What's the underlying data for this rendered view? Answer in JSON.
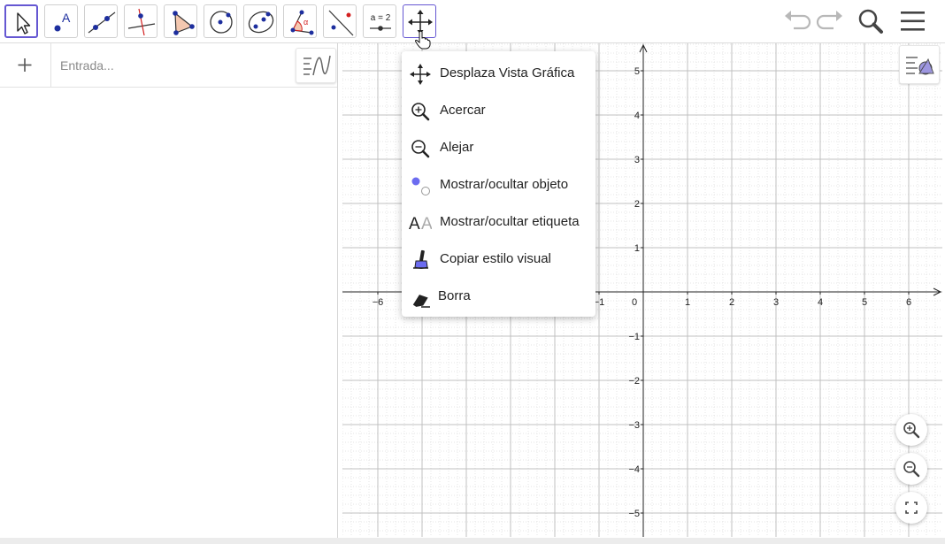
{
  "toolbar": {
    "tools": [
      {
        "name": "move-tool",
        "icon": "arrow-pointer-icon",
        "active": true
      },
      {
        "name": "point-tool",
        "icon": "point-label-icon",
        "label_glyph": "A"
      },
      {
        "name": "line-tool",
        "icon": "line-icon"
      },
      {
        "name": "perpendicular-tool",
        "icon": "perpendicular-line-icon"
      },
      {
        "name": "polygon-tool",
        "icon": "polygon-icon"
      },
      {
        "name": "circle-tool",
        "icon": "circle-center-point-icon"
      },
      {
        "name": "conic-tool",
        "icon": "ellipse-icon"
      },
      {
        "name": "angle-tool",
        "icon": "angle-icon",
        "label_glyph": "α"
      },
      {
        "name": "reflect-tool",
        "icon": "reflect-line-icon"
      },
      {
        "name": "slider-tool",
        "icon": "slider-icon",
        "label_glyph": "a = 2"
      },
      {
        "name": "move-graphics-tool",
        "icon": "move-arrows-icon",
        "hover": true
      }
    ],
    "right": {
      "undo": "undo-icon",
      "redo": "redo-icon",
      "search": "search-icon",
      "menu": "hamburger-menu-icon"
    }
  },
  "algebra": {
    "input_placeholder": "Entrada...",
    "add_icon": "plus-icon",
    "menu_icon": "algebra-view-menu-icon"
  },
  "graphics": {
    "x_ticks": [
      "−6",
      "−5",
      "−4",
      "−3",
      "−2",
      "−1",
      "0",
      "1",
      "2",
      "3",
      "4",
      "5",
      "6"
    ],
    "y_ticks": [
      "5",
      "4",
      "3",
      "2",
      "1",
      "−1",
      "−2",
      "−3",
      "−4",
      "−5"
    ],
    "x_range": [
      -6.8,
      6.8
    ],
    "y_range": [
      -5.6,
      5.6
    ],
    "grid": true,
    "style_bar_icon": "graphics-style-bar-icon",
    "zoom_in_icon": "zoom-in-icon",
    "zoom_out_icon": "zoom-out-icon",
    "fullscreen_icon": "fullscreen-icon"
  },
  "dropdown": {
    "items": [
      {
        "name": "move-graphics-view",
        "label": "Desplaza Vista Gráfica",
        "icon": "move-arrows-icon"
      },
      {
        "name": "zoom-in",
        "label": "Acercar",
        "icon": "zoom-in-icon"
      },
      {
        "name": "zoom-out",
        "label": "Alejar",
        "icon": "zoom-out-icon"
      },
      {
        "name": "show-hide-object",
        "label": "Mostrar/ocultar objeto",
        "icon": "show-hide-object-icon"
      },
      {
        "name": "show-hide-label",
        "label": "Mostrar/ocultar etiqueta",
        "icon": "show-hide-label-icon",
        "glyph": "AA"
      },
      {
        "name": "copy-visual-style",
        "label": "Copiar estilo visual",
        "icon": "paint-brush-icon"
      },
      {
        "name": "delete",
        "label": "Borra",
        "icon": "eraser-icon"
      }
    ]
  },
  "colors": {
    "accent": "#6557d2",
    "point_blue": "#1d2e9e",
    "grid_major": "#c0c0c0",
    "grid_minor": "#e6e6e6",
    "red": "#d32020"
  }
}
